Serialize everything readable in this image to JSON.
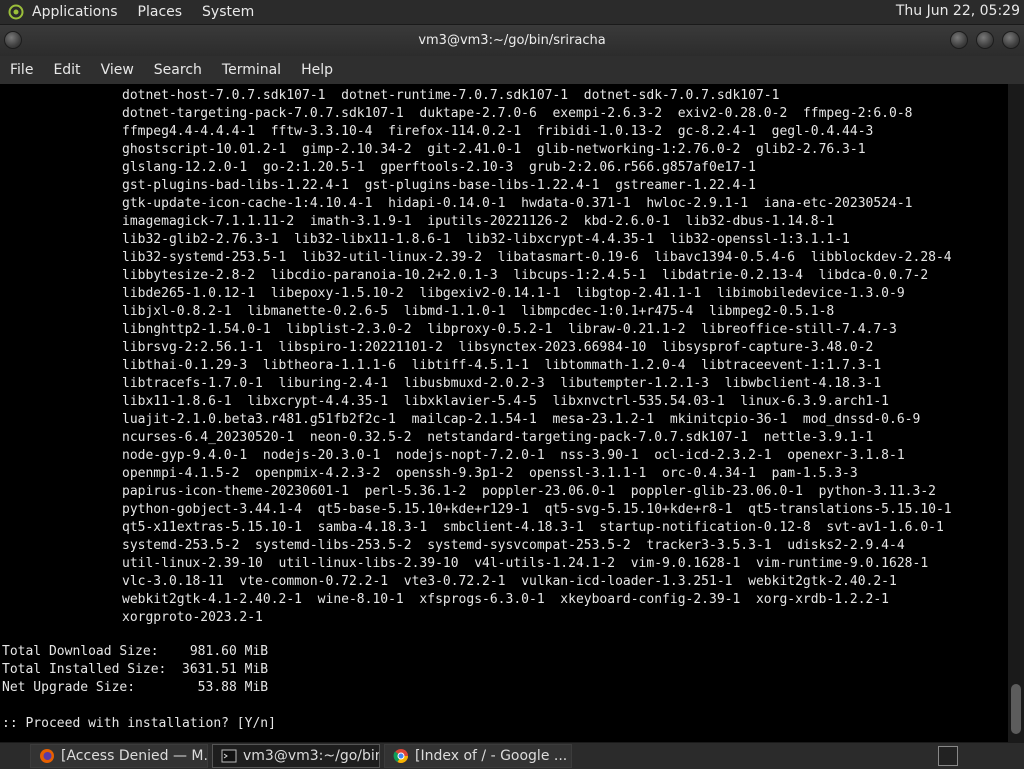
{
  "top_panel": {
    "menus": [
      "Applications",
      "Places",
      "System"
    ],
    "clock": "Thu Jun 22, 05:29"
  },
  "window": {
    "title": "vm3@vm3:~/go/bin/sriracha"
  },
  "menubar": {
    "items": [
      "File",
      "Edit",
      "View",
      "Search",
      "Terminal",
      "Help"
    ]
  },
  "terminal": {
    "package_lines": [
      "dotnet-host-7.0.7.sdk107-1  dotnet-runtime-7.0.7.sdk107-1  dotnet-sdk-7.0.7.sdk107-1",
      "dotnet-targeting-pack-7.0.7.sdk107-1  duktape-2.7.0-6  exempi-2.6.3-2  exiv2-0.28.0-2  ffmpeg-2:6.0-8",
      "ffmpeg4.4-4.4.4-1  fftw-3.3.10-4  firefox-114.0.2-1  fribidi-1.0.13-2  gc-8.2.4-1  gegl-0.4.44-3",
      "ghostscript-10.01.2-1  gimp-2.10.34-2  git-2.41.0-1  glib-networking-1:2.76.0-2  glib2-2.76.3-1",
      "glslang-12.2.0-1  go-2:1.20.5-1  gperftools-2.10-3  grub-2:2.06.r566.g857af0e17-1",
      "gst-plugins-bad-libs-1.22.4-1  gst-plugins-base-libs-1.22.4-1  gstreamer-1.22.4-1",
      "gtk-update-icon-cache-1:4.10.4-1  hidapi-0.14.0-1  hwdata-0.371-1  hwloc-2.9.1-1  iana-etc-20230524-1",
      "imagemagick-7.1.1.11-2  imath-3.1.9-1  iputils-20221126-2  kbd-2.6.0-1  lib32-dbus-1.14.8-1",
      "lib32-glib2-2.76.3-1  lib32-libx11-1.8.6-1  lib32-libxcrypt-4.4.35-1  lib32-openssl-1:3.1.1-1",
      "lib32-systemd-253.5-1  lib32-util-linux-2.39-2  libatasmart-0.19-6  libavc1394-0.5.4-6  libblockdev-2.28-4",
      "libbytesize-2.8-2  libcdio-paranoia-10.2+2.0.1-3  libcups-1:2.4.5-1  libdatrie-0.2.13-4  libdca-0.0.7-2",
      "libde265-1.0.12-1  libepoxy-1.5.10-2  libgexiv2-0.14.1-1  libgtop-2.41.1-1  libimobiledevice-1.3.0-9",
      "libjxl-0.8.2-1  libmanette-0.2.6-5  libmd-1.1.0-1  libmpcdec-1:0.1+r475-4  libmpeg2-0.5.1-8",
      "libnghttp2-1.54.0-1  libplist-2.3.0-2  libproxy-0.5.2-1  libraw-0.21.1-2  libreoffice-still-7.4.7-3",
      "librsvg-2:2.56.1-1  libspiro-1:20221101-2  libsynctex-2023.66984-10  libsysprof-capture-3.48.0-2",
      "libthai-0.1.29-3  libtheora-1.1.1-6  libtiff-4.5.1-1  libtommath-1.2.0-4  libtraceevent-1:1.7.3-1",
      "libtracefs-1.7.0-1  liburing-2.4-1  libusbmuxd-2.0.2-3  libutempter-1.2.1-3  libwbclient-4.18.3-1",
      "libx11-1.8.6-1  libxcrypt-4.4.35-1  libxklavier-5.4-5  libxnvctrl-535.54.03-1  linux-6.3.9.arch1-1",
      "luajit-2.1.0.beta3.r481.g51fb2f2c-1  mailcap-2.1.54-1  mesa-23.1.2-1  mkinitcpio-36-1  mod_dnssd-0.6-9",
      "ncurses-6.4_20230520-1  neon-0.32.5-2  netstandard-targeting-pack-7.0.7.sdk107-1  nettle-3.9.1-1",
      "node-gyp-9.4.0-1  nodejs-20.3.0-1  nodejs-nopt-7.2.0-1  nss-3.90-1  ocl-icd-2.3.2-1  openexr-3.1.8-1",
      "openmpi-4.1.5-2  openpmix-4.2.3-2  openssh-9.3p1-2  openssl-3.1.1-1  orc-0.4.34-1  pam-1.5.3-3",
      "papirus-icon-theme-20230601-1  perl-5.36.1-2  poppler-23.06.0-1  poppler-glib-23.06.0-1  python-3.11.3-2",
      "python-gobject-3.44.1-4  qt5-base-5.15.10+kde+r129-1  qt5-svg-5.15.10+kde+r8-1  qt5-translations-5.15.10-1",
      "qt5-x11extras-5.15.10-1  samba-4.18.3-1  smbclient-4.18.3-1  startup-notification-0.12-8  svt-av1-1.6.0-1",
      "systemd-253.5-2  systemd-libs-253.5-2  systemd-sysvcompat-253.5-2  tracker3-3.5.3-1  udisks2-2.9.4-4",
      "util-linux-2.39-10  util-linux-libs-2.39-10  v4l-utils-1.24.1-2  vim-9.0.1628-1  vim-runtime-9.0.1628-1",
      "vlc-3.0.18-11  vte-common-0.72.2-1  vte3-0.72.2-1  vulkan-icd-loader-1.3.251-1  webkit2gtk-2.40.2-1",
      "webkit2gtk-4.1-2.40.2-1  wine-8.10-1  xfsprogs-6.3.0-1  xkeyboard-config-2.39-1  xorg-xrdb-1.2.2-1",
      "xorgproto-2023.2-1"
    ],
    "summary_lines": [
      "Total Download Size:    981.60 MiB",
      "Total Installed Size:  3631.51 MiB",
      "Net Upgrade Size:        53.88 MiB"
    ],
    "prompt": ":: Proceed with installation? [Y/n]"
  },
  "taskbar": {
    "tasks": [
      {
        "label": "[Access Denied — M...",
        "icon": "firefox-icon"
      },
      {
        "label": "vm3@vm3:~/go/bin....",
        "icon": "terminal-icon"
      },
      {
        "label": "[Index of / - Google ...",
        "icon": "chrome-icon"
      }
    ]
  }
}
